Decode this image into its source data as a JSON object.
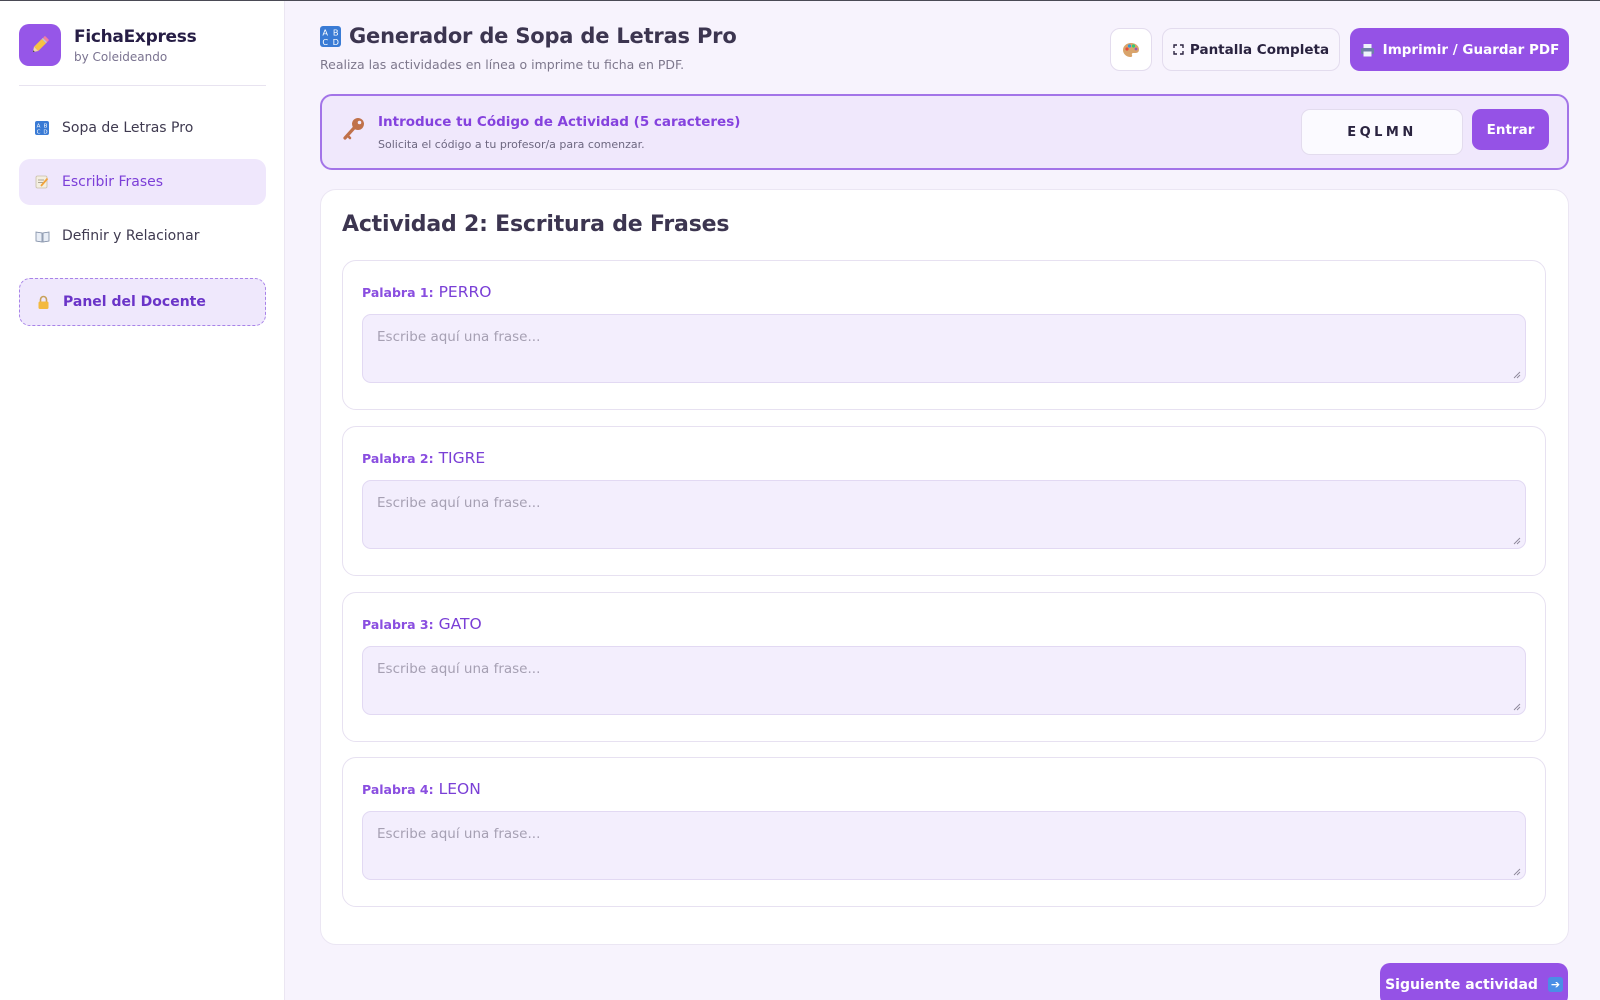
{
  "brand": {
    "name": "FichaExpress",
    "subtitle": "by Coleideando"
  },
  "sidebar": {
    "items": [
      {
        "label": "Sopa de Letras Pro",
        "icon": "abcd-icon",
        "active": false
      },
      {
        "label": "Escribir Frases",
        "icon": "memo-icon",
        "active": true
      },
      {
        "label": "Definir y Relacionar",
        "icon": "book-icon",
        "active": false
      }
    ],
    "teacher_panel": {
      "label": "Panel del Docente",
      "icon": "lock-icon"
    }
  },
  "header": {
    "title": "Generador de Sopa de Letras Pro",
    "subtitle": "Realiza las actividades en línea o imprime tu ficha en PDF.",
    "palette_icon": "palette-icon",
    "fullscreen_label": "Pantalla Completa",
    "print_label": "Imprimir / Guardar PDF"
  },
  "code_banner": {
    "title": "Introduce tu Código de Actividad (5 caracteres)",
    "hint": "Solicita el código a tu profesor/a para comenzar.",
    "code_value": "EQLMN",
    "enter_label": "Entrar"
  },
  "activity": {
    "title": "Actividad 2: Escritura de Frases",
    "words": [
      {
        "label": "Palabra 1:",
        "word": "PERRO",
        "placeholder": "Escribe aquí una frase..."
      },
      {
        "label": "Palabra 2:",
        "word": "TIGRE",
        "placeholder": "Escribe aquí una frase..."
      },
      {
        "label": "Palabra 3:",
        "word": "GATO",
        "placeholder": "Escribe aquí una frase..."
      },
      {
        "label": "Palabra 4:",
        "word": "LEON",
        "placeholder": "Escribe aquí una frase..."
      }
    ]
  },
  "footer": {
    "next_label": "Siguiente actividad",
    "next_icon": "arrow-right-icon"
  },
  "colors": {
    "accent": "#9552e6",
    "accent_light": "#efe7fc",
    "background": "#f7f3fd"
  }
}
